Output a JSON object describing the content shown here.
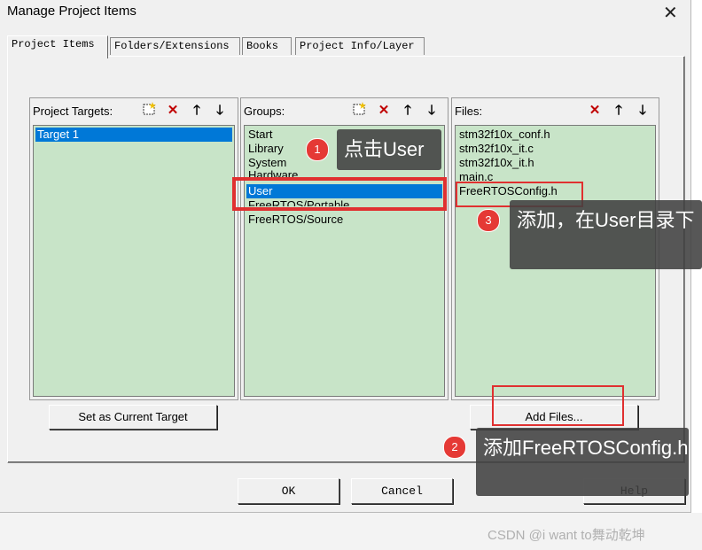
{
  "window": {
    "title": "Manage Project Items",
    "close_glyph": "✕"
  },
  "tabs": [
    {
      "label": "Project Items"
    },
    {
      "label": "Folders/Extensions"
    },
    {
      "label": "Books"
    },
    {
      "label": "Project Info/Layer"
    }
  ],
  "targets": {
    "header": "Project Targets:",
    "items": [
      "Target 1"
    ],
    "set_current_label": "Set as Current Target"
  },
  "groups": {
    "header": "Groups:",
    "items": [
      "Start",
      "Library",
      "System",
      "Hardware",
      "User",
      "FreeRTOS/Portable",
      "FreeRTOS/Source"
    ]
  },
  "files": {
    "header": "Files:",
    "items": [
      "stm32f10x_conf.h",
      "stm32f10x_it.c",
      "stm32f10x_it.h",
      "main.c",
      "FreeRTOSConfig.h"
    ],
    "add_files_label": "Add Files..."
  },
  "toolbar_icons": {
    "new": "new-item-icon",
    "delete": "delete-icon",
    "up": "move-up-icon",
    "down": "move-down-icon"
  },
  "buttons": {
    "ok": "OK",
    "cancel": "Cancel",
    "help": "Help"
  },
  "annotations": [
    {
      "num": "1",
      "text": "点击User"
    },
    {
      "num": "2",
      "text": "添加FreeRTOSConfig.h"
    },
    {
      "num": "3",
      "text": "添加，在User目录下"
    }
  ],
  "watermark": "CSDN @i want to舞动乾坤",
  "colors": {
    "list_bg": "#c8e4c8",
    "selection": "#0078d7",
    "highlight_box": "#e03030",
    "callout_bg": "#404040",
    "badge": "#e53935"
  }
}
